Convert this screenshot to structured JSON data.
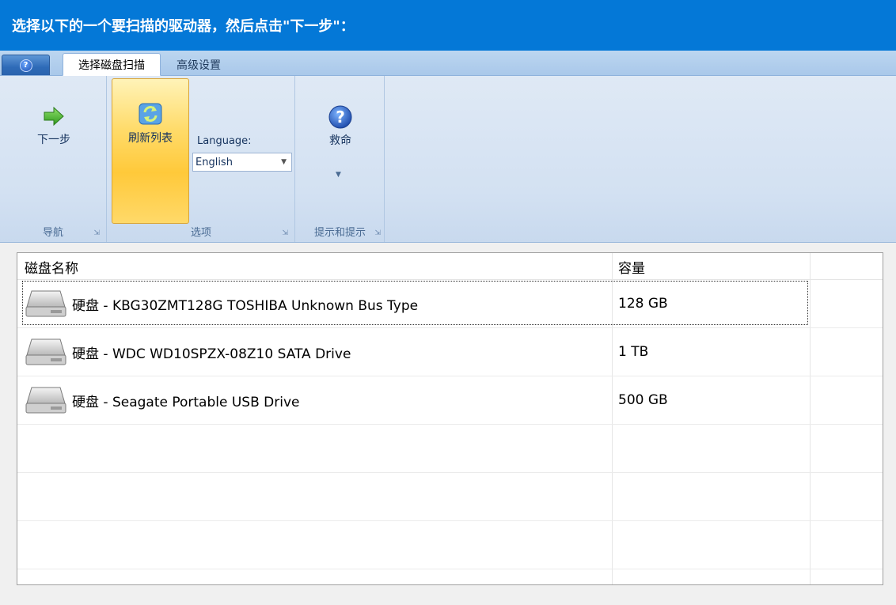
{
  "title": "选择以下的一个要扫描的驱动器，然后点击\"下一步\"：",
  "tabs": {
    "active": "选择磁盘扫描",
    "inactive": "高级设置"
  },
  "app_button_icon": "help-icon",
  "ribbon": {
    "navigation": {
      "next_label": "下一步",
      "group_label": "导航",
      "icon": "arrow-right-icon"
    },
    "options": {
      "refresh_label": "刷新列表",
      "refresh_icon": "refresh-icon",
      "language_label": "Language:",
      "language_value": "English",
      "group_label": "选项"
    },
    "tips": {
      "help_label": "救命",
      "help_icon": "help-icon",
      "group_label": "提示和提示"
    }
  },
  "table": {
    "columns": [
      "磁盘名称",
      "容量"
    ],
    "rows": [
      {
        "name": "硬盘 - KBG30ZMT128G TOSHIBA Unknown Bus Type",
        "capacity": "128 GB"
      },
      {
        "name": "硬盘 - WDC WD10SPZX-08Z10 SATA Drive",
        "capacity": "1 TB"
      },
      {
        "name": "硬盘 - Seagate Portable USB Drive",
        "capacity": "500 GB"
      }
    ],
    "selected_index": 0
  },
  "colors": {
    "title_bar": "#0478d7",
    "refresh_highlight": "#ffc93a",
    "next_arrow": "#43b02a"
  }
}
